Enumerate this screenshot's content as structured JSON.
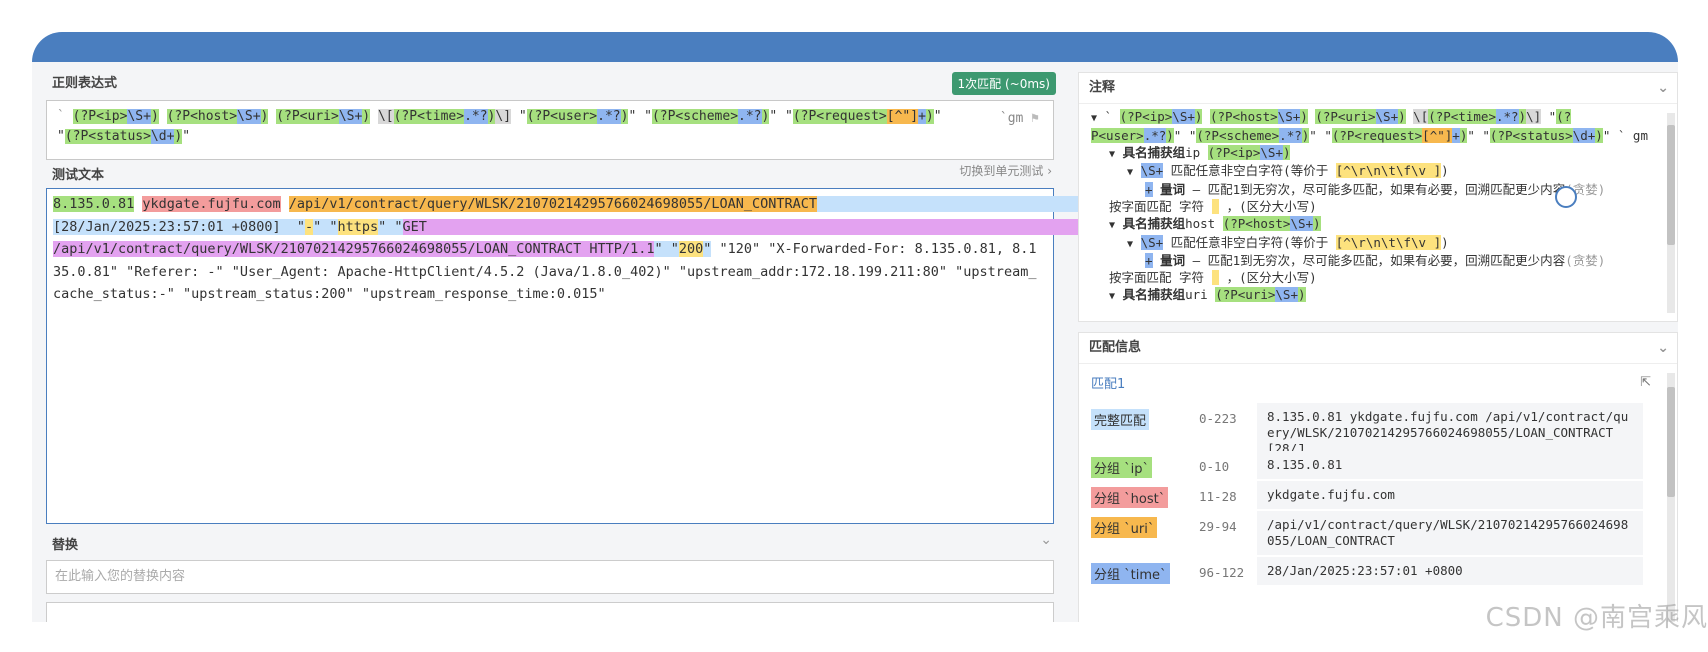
{
  "regex_section": {
    "title": "正则表达式",
    "badge": "1次匹配 (~0ms)",
    "flags": "gm",
    "delimiter": "`"
  },
  "test_section": {
    "title": "测试文本",
    "switch_label": "切换到单元测试 ›"
  },
  "test_text": {
    "ip": "8.135.0.81",
    "host": "ykdgate.fujfu.com",
    "uri": "/api/v1/contract/query/WLSK/2107021429576602469805 5/LOAN_CONTRACT",
    "rest": " \"120\" \"X-Forwarded-For: 8.135.0.81, 8.135.0.81\" \"Referer: -\" \"User_Agent: Apache-HttpClient/4.5.2 (Java/1.8.0_402)\" \"upstream_addr:172.18.199.211:80\" \"upstream_cache_status:-\" \"upstream_status:200\" \"upstream_response_time:0.015\""
  },
  "replace_section": {
    "title": "替换",
    "placeholder": "在此输入您的替换内容"
  },
  "explain_panel": {
    "title": "注释",
    "group_ip": "具名捕获组",
    "name_ip": "ip",
    "group_host": "具名捕获组",
    "name_host": "host",
    "group_uri": "具名捕获组",
    "name_uri": "uri",
    "s_desc": "匹配任意非空白字符(等价于",
    "quant_label": "量词",
    "quant_desc": "— 匹配1到无穷次，尽可能多匹配，如果有必要，回溯匹配更少内容",
    "greedy": "(贪婪)",
    "literal": "按字面匹配 字符",
    "case": "，(区分大小写)"
  },
  "match_panel": {
    "title": "匹配信息",
    "match_link": "匹配1",
    "rows": [
      {
        "label": "完整匹配",
        "range": "0-223",
        "value": "8.135.0.81 ykdgate.fujfu.com /api/v1/contract/query/WLSK/21070214295766024698055/LOAN_CONTRACT [28/J...",
        "color": "#c5e1fb"
      },
      {
        "label": "分组 `ip`",
        "range": "0-10",
        "value": "8.135.0.81",
        "color": "#a6e07f"
      },
      {
        "label": "分组 `host`",
        "range": "11-28",
        "value": "ykdgate.fujfu.com",
        "color": "#f39c9c"
      },
      {
        "label": "分组 `uri`",
        "range": "29-94",
        "value": "/api/v1/contract/query/WLSK/21070214295766024698055/LOAN_CONTRACT",
        "color": "#f7b84e"
      },
      {
        "label": "分组 `time`",
        "range": "96-122",
        "value": "28/Jan/2025:23:57:01 +0800",
        "color": "#8fb5f0"
      }
    ]
  },
  "watermark": "CSDN @南宫乘风",
  "colors": {
    "accent": "#4a7ebf",
    "badge": "#3d9970"
  }
}
